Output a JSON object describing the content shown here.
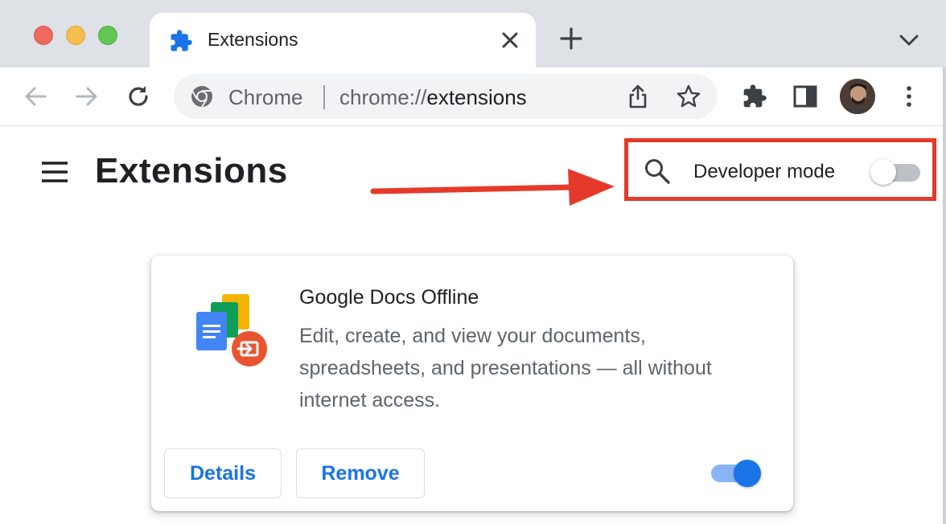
{
  "window": {
    "tab": {
      "title": "Extensions",
      "icon": "puzzle-piece-icon"
    },
    "traffic_lights": {
      "close_color": "#ee6a5f",
      "minimize_color": "#f5be4f",
      "maximize_color": "#62c554"
    }
  },
  "toolbar": {
    "omnibox": {
      "chip": "Chrome",
      "url_scheme": "chrome://",
      "url_host": "extensions"
    }
  },
  "page": {
    "title": "Extensions",
    "developer_mode": {
      "label": "Developer mode",
      "enabled": false
    }
  },
  "extension": {
    "name": "Google Docs Offline",
    "description": "Edit, create, and view your documents, spreadsheets, and presentations — all without internet access.",
    "details_label": "Details",
    "remove_label": "Remove",
    "enabled": true
  },
  "colors": {
    "accent": "#1a73e8",
    "annotation_red": "#e53a2a",
    "tabstrip": "#dee1e6"
  }
}
